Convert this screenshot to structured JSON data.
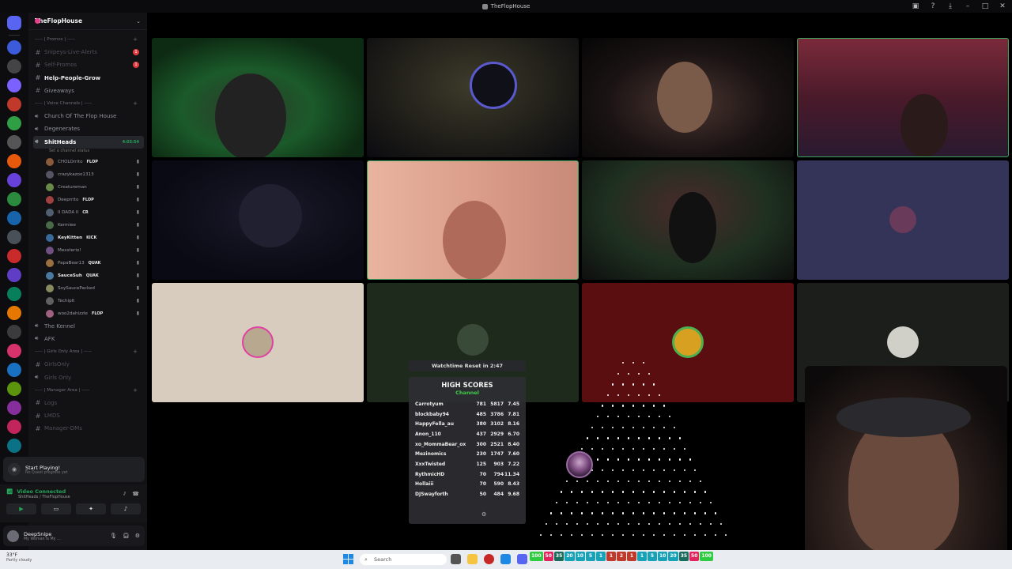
{
  "window": {
    "title": "TheFlopHouse"
  },
  "server": {
    "name": "TheFlopHouse"
  },
  "channels": [
    {
      "kind": "cat",
      "label": "----- | Promos | -----"
    },
    {
      "kind": "text",
      "label": "Snipeys-Live-Alerts",
      "badge": "1",
      "style": "dim"
    },
    {
      "kind": "text",
      "label": "Self-Promos",
      "badge": "1",
      "style": "dim"
    },
    {
      "kind": "text",
      "label": "Help-People-Grow",
      "style": "bright"
    },
    {
      "kind": "text",
      "label": "Giveaways",
      "style": "normal"
    },
    {
      "kind": "cat",
      "label": "----- | Voice Channels | -----"
    },
    {
      "kind": "voice",
      "label": "Church Of The Flop House",
      "style": "normal"
    },
    {
      "kind": "voice",
      "label": "Degenerates",
      "style": "normal"
    },
    {
      "kind": "voice",
      "label": "ShitHeads",
      "style": "active",
      "timer": "4:03:54"
    }
  ],
  "status_line": "Set a channel status",
  "members": [
    {
      "name": "CHOLOrrito",
      "tag": "FLOP",
      "bold": false
    },
    {
      "name": "crazykazoo1313",
      "tag": "",
      "bold": false
    },
    {
      "name": "Creatureman",
      "tag": "",
      "bold": false
    },
    {
      "name": "Deeprrito",
      "tag": "FLOP",
      "bold": false
    },
    {
      "name": "II DADA II",
      "tag": "CR",
      "bold": false
    },
    {
      "name": "Kermiee",
      "tag": "",
      "bold": false
    },
    {
      "name": "KeyKitten",
      "tag": "KICK",
      "bold": true
    },
    {
      "name": "Mexsterio!",
      "tag": "",
      "bold": false
    },
    {
      "name": "PapaBear13",
      "tag": "QUAK",
      "bold": false
    },
    {
      "name": "SauceSuh",
      "tag": "QUAK",
      "bold": true
    },
    {
      "name": "SoySaucePacked",
      "tag": "",
      "bold": false
    },
    {
      "name": "Techiplt",
      "tag": "",
      "bold": false
    },
    {
      "name": "woo2dahizzle",
      "tag": "FLOP",
      "bold": false
    }
  ],
  "channels2": [
    {
      "kind": "voice",
      "label": "The Kennel",
      "style": "normal"
    },
    {
      "kind": "voice",
      "label": "AFK",
      "style": "normal"
    },
    {
      "kind": "cat",
      "label": "----- | Girls Only Area | -----"
    },
    {
      "kind": "text",
      "label": "GirlsOnly",
      "style": "dim"
    },
    {
      "kind": "voice",
      "label": "Girls Only",
      "style": "dim"
    },
    {
      "kind": "cat",
      "label": "----- | Manager Area | -----"
    },
    {
      "kind": "text",
      "label": "Logs",
      "style": "dim"
    },
    {
      "kind": "text",
      "label": "LMDS",
      "style": "dim"
    },
    {
      "kind": "text",
      "label": "Manager-DMs",
      "style": "dim"
    }
  ],
  "quest": {
    "title": "Start Playing!",
    "subtitle": "No Quest progress yet"
  },
  "voice": {
    "status": "Video Connected",
    "location": "ShitHeads / TheFlopHouse"
  },
  "user": {
    "name": "DeepSnipe",
    "status": "My Woman Is My ..."
  },
  "overlay": {
    "watchtime": "Watchtime Reset in 2:47",
    "title": "HIGH SCORES",
    "subtitle": "Channel",
    "rows": [
      {
        "name": "Carrotyum",
        "a": "781",
        "b": "5817",
        "c": "7.45"
      },
      {
        "name": "blockbaby94",
        "a": "485",
        "b": "3786",
        "c": "7.81"
      },
      {
        "name": "HappyFella_au",
        "a": "380",
        "b": "3102",
        "c": "8.16"
      },
      {
        "name": "Anon_110",
        "a": "437",
        "b": "2929",
        "c": "6.70"
      },
      {
        "name": "xo_MommaBear_ox",
        "a": "300",
        "b": "2521",
        "b2": "",
        "c": "8.40"
      },
      {
        "name": "Mezinomics",
        "a": "230",
        "b": "1747",
        "c": "7.60"
      },
      {
        "name": "XxxTwisted",
        "a": "125",
        "b": "903",
        "c": "7.22"
      },
      {
        "name": "RythmicHD",
        "a": "70",
        "b": "794",
        "c": "11.34"
      },
      {
        "name": "Hollaiii",
        "a": "70",
        "b": "590",
        "c": "8.43"
      },
      {
        "name": "DJSwayforth",
        "a": "50",
        "b": "484",
        "c": "9.68"
      }
    ]
  },
  "taskbar": {
    "temp": "33°F",
    "weather": "Partly cloudy",
    "search": "Search",
    "multipliers": [
      {
        "v": "100",
        "c": "#2ecc40"
      },
      {
        "v": "50",
        "c": "#e0245e"
      },
      {
        "v": "35",
        "c": "#1a6b5c"
      },
      {
        "v": "20",
        "c": "#17a2b8"
      },
      {
        "v": "10",
        "c": "#17a2b8"
      },
      {
        "v": "5",
        "c": "#17a2b8"
      },
      {
        "v": "1",
        "c": "#17a2b8"
      },
      {
        "v": "1",
        "c": "#c0392b"
      },
      {
        "v": "2",
        "c": "#c0392b"
      },
      {
        "v": "1",
        "c": "#c0392b"
      },
      {
        "v": "1",
        "c": "#17a2b8"
      },
      {
        "v": "5",
        "c": "#17a2b8"
      },
      {
        "v": "10",
        "c": "#17a2b8"
      },
      {
        "v": "20",
        "c": "#17a2b8"
      },
      {
        "v": "35",
        "c": "#1a6b5c"
      },
      {
        "v": "50",
        "c": "#e0245e"
      },
      {
        "v": "100",
        "c": "#2ecc40"
      }
    ]
  },
  "colors": {
    "accent": "#5865f2",
    "voice_green": "#23a55a",
    "alert_red": "#e03d3f"
  }
}
